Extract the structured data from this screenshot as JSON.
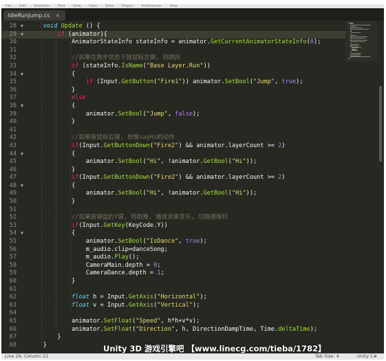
{
  "menubar": {
    "items": [
      "File",
      "Edit",
      "Selection",
      "Find",
      "View",
      "Goto",
      "Tools",
      "Project",
      "Preferences",
      "Help"
    ]
  },
  "tab": {
    "label": "IdleRunJump.cs",
    "close": "×"
  },
  "code": {
    "lines": [
      {
        "n": "28",
        "current": false,
        "fold": "▼",
        "tokens": [
          [
            "pl",
            "    "
          ],
          [
            "ty",
            "void"
          ],
          [
            "pl",
            " "
          ],
          [
            "fn",
            "Update"
          ],
          [
            "pl",
            " () {"
          ]
        ]
      },
      {
        "n": "29",
        "current": true,
        "fold": "▼",
        "tokens": [
          [
            "pl",
            "        "
          ],
          [
            "kw",
            "if"
          ],
          [
            "pl",
            " (animator){"
          ]
        ]
      },
      {
        "n": "30",
        "current": false,
        "fold": "",
        "tokens": [
          [
            "pl",
            "            AnimatorStateInfo stateInfo = animator."
          ],
          [
            "fn",
            "GetCurrentAnimatorStateInfo"
          ],
          [
            "pl",
            "("
          ],
          [
            "nu",
            "0"
          ],
          [
            "pl",
            ");"
          ]
        ]
      },
      {
        "n": "31",
        "current": false,
        "fold": "",
        "tokens": []
      },
      {
        "n": "32",
        "current": false,
        "fold": "",
        "tokens": [
          [
            "pl",
            "            "
          ],
          [
            "cm",
            "//如果在跑步状态下按鼠标左键, 则跳跃"
          ]
        ]
      },
      {
        "n": "33",
        "current": false,
        "fold": "",
        "tokens": [
          [
            "pl",
            "            "
          ],
          [
            "kw",
            "if"
          ],
          [
            "pl",
            " (stateInfo."
          ],
          [
            "fn",
            "IsName"
          ],
          [
            "pl",
            "("
          ],
          [
            "st",
            "\"Base Layer.Run\""
          ],
          [
            "pl",
            "))"
          ]
        ]
      },
      {
        "n": "34",
        "current": false,
        "fold": "▼",
        "tokens": [
          [
            "pl",
            "            {"
          ]
        ]
      },
      {
        "n": "35",
        "current": false,
        "fold": "",
        "tokens": [
          [
            "pl",
            "                "
          ],
          [
            "kw",
            "if"
          ],
          [
            "pl",
            " (Input."
          ],
          [
            "fn",
            "GetButton"
          ],
          [
            "pl",
            "("
          ],
          [
            "st",
            "\"Fire1\""
          ],
          [
            "pl",
            ")) animator."
          ],
          [
            "fn",
            "SetBool"
          ],
          [
            "pl",
            "("
          ],
          [
            "st",
            "\"Jump\""
          ],
          [
            "pl",
            ", "
          ],
          [
            "nu",
            "true"
          ],
          [
            "pl",
            ");"
          ]
        ]
      },
      {
        "n": "36",
        "current": false,
        "fold": "",
        "tokens": [
          [
            "pl",
            "            }"
          ]
        ]
      },
      {
        "n": "37",
        "current": false,
        "fold": "",
        "tokens": [
          [
            "pl",
            "            "
          ],
          [
            "kw",
            "else"
          ]
        ]
      },
      {
        "n": "38",
        "current": false,
        "fold": "▼",
        "tokens": [
          [
            "pl",
            "            {"
          ]
        ]
      },
      {
        "n": "39",
        "current": false,
        "fold": "",
        "tokens": [
          [
            "pl",
            "                animator."
          ],
          [
            "fn",
            "SetBool"
          ],
          [
            "pl",
            "("
          ],
          [
            "st",
            "\"Jump\""
          ],
          [
            "pl",
            ", "
          ],
          [
            "nu",
            "false"
          ],
          [
            "pl",
            ");"
          ]
        ]
      },
      {
        "n": "40",
        "current": false,
        "fold": "",
        "tokens": [
          [
            "pl",
            "            }"
          ]
        ]
      },
      {
        "n": "41",
        "current": false,
        "fold": "",
        "tokens": []
      },
      {
        "n": "42",
        "current": false,
        "fold": "",
        "tokens": [
          [
            "pl",
            "            "
          ],
          [
            "cm",
            "//如果按鼠标右键, 就做sayHi的动作"
          ]
        ]
      },
      {
        "n": "43",
        "current": false,
        "fold": "",
        "tokens": [
          [
            "pl",
            "            "
          ],
          [
            "kw",
            "if"
          ],
          [
            "pl",
            "(Input."
          ],
          [
            "fn",
            "GetButtonDown"
          ],
          [
            "pl",
            "("
          ],
          [
            "st",
            "\"Fire2\""
          ],
          [
            "pl",
            ") && animator.layerCount >= "
          ],
          [
            "nu",
            "2"
          ],
          [
            "pl",
            ")"
          ]
        ]
      },
      {
        "n": "44",
        "current": false,
        "fold": "▼",
        "tokens": [
          [
            "pl",
            "            {"
          ]
        ]
      },
      {
        "n": "45",
        "current": false,
        "fold": "",
        "tokens": [
          [
            "pl",
            "                animator."
          ],
          [
            "fn",
            "SetBool"
          ],
          [
            "pl",
            "("
          ],
          [
            "st",
            "\"Hi\""
          ],
          [
            "pl",
            ", !animator."
          ],
          [
            "fn",
            "GetBool"
          ],
          [
            "pl",
            "("
          ],
          [
            "st",
            "\"Hi\""
          ],
          [
            "pl",
            "));"
          ]
        ]
      },
      {
        "n": "46",
        "current": false,
        "fold": "",
        "tokens": [
          [
            "pl",
            "            }"
          ]
        ]
      },
      {
        "n": "47",
        "current": false,
        "fold": "",
        "tokens": [
          [
            "pl",
            "            "
          ],
          [
            "kw",
            "if"
          ],
          [
            "pl",
            "(Input."
          ],
          [
            "fn",
            "GetButtonDown"
          ],
          [
            "pl",
            "("
          ],
          [
            "st",
            "\"Fire2\""
          ],
          [
            "pl",
            ") && animator.layerCount >= "
          ],
          [
            "nu",
            "2"
          ],
          [
            "pl",
            ")"
          ]
        ]
      },
      {
        "n": "48",
        "current": false,
        "fold": "▼",
        "tokens": [
          [
            "pl",
            "            {"
          ]
        ]
      },
      {
        "n": "49",
        "current": false,
        "fold": "",
        "tokens": [
          [
            "pl",
            "                animator."
          ],
          [
            "fn",
            "SetBool"
          ],
          [
            "pl",
            "("
          ],
          [
            "st",
            "\"Hi\""
          ],
          [
            "pl",
            ", !animator."
          ],
          [
            "fn",
            "GetBool"
          ],
          [
            "pl",
            "("
          ],
          [
            "st",
            "\"Hi\""
          ],
          [
            "pl",
            "));"
          ]
        ]
      },
      {
        "n": "50",
        "current": false,
        "fold": "",
        "tokens": [
          [
            "pl",
            "            }"
          ]
        ]
      },
      {
        "n": "51",
        "current": false,
        "fold": "",
        "tokens": []
      },
      {
        "n": "52",
        "current": false,
        "fold": "",
        "tokens": [
          [
            "pl",
            "            "
          ],
          [
            "cm",
            "//如果按键盘的Y键, 则跳舞, 播放背景音乐, 切换摄像机"
          ]
        ]
      },
      {
        "n": "53",
        "current": false,
        "fold": "",
        "tokens": [
          [
            "pl",
            "            "
          ],
          [
            "kw",
            "if"
          ],
          [
            "pl",
            "(Input."
          ],
          [
            "fn",
            "GetKey"
          ],
          [
            "pl",
            "(KeyCode.Y))"
          ]
        ]
      },
      {
        "n": "54",
        "current": false,
        "fold": "▼",
        "tokens": [
          [
            "pl",
            "            {"
          ]
        ]
      },
      {
        "n": "55",
        "current": false,
        "fold": "",
        "tokens": [
          [
            "pl",
            "                animator."
          ],
          [
            "fn",
            "SetBool"
          ],
          [
            "pl",
            "("
          ],
          [
            "st",
            "\"IsDance\""
          ],
          [
            "pl",
            ", "
          ],
          [
            "nu",
            "true"
          ],
          [
            "pl",
            ");"
          ]
        ]
      },
      {
        "n": "56",
        "current": false,
        "fold": "",
        "tokens": [
          [
            "pl",
            "                m_audio.clip=danceSong;"
          ]
        ]
      },
      {
        "n": "57",
        "current": false,
        "fold": "",
        "tokens": [
          [
            "pl",
            "                m_audio."
          ],
          [
            "fn",
            "Play"
          ],
          [
            "pl",
            "();"
          ]
        ]
      },
      {
        "n": "58",
        "current": false,
        "fold": "",
        "tokens": [
          [
            "pl",
            "                CameraMain.depth = "
          ],
          [
            "nu",
            "0"
          ],
          [
            "pl",
            ";"
          ]
        ]
      },
      {
        "n": "59",
        "current": false,
        "fold": "",
        "tokens": [
          [
            "pl",
            "                CameraDance.depth = "
          ],
          [
            "nu",
            "1"
          ],
          [
            "pl",
            ";"
          ]
        ]
      },
      {
        "n": "60",
        "current": false,
        "fold": "",
        "tokens": [
          [
            "pl",
            "            }"
          ]
        ]
      },
      {
        "n": "61",
        "current": false,
        "fold": "",
        "tokens": []
      },
      {
        "n": "62",
        "current": false,
        "fold": "",
        "tokens": [
          [
            "pl",
            "            "
          ],
          [
            "ty",
            "float"
          ],
          [
            "pl",
            " h = Input."
          ],
          [
            "fn",
            "GetAxis"
          ],
          [
            "pl",
            "("
          ],
          [
            "st",
            "\"Horizontal\""
          ],
          [
            "pl",
            ");"
          ]
        ]
      },
      {
        "n": "63",
        "current": false,
        "fold": "",
        "tokens": [
          [
            "pl",
            "            "
          ],
          [
            "ty",
            "float"
          ],
          [
            "pl",
            " v = Input."
          ],
          [
            "fn",
            "GetAxis"
          ],
          [
            "pl",
            "("
          ],
          [
            "st",
            "\"Vertical\""
          ],
          [
            "pl",
            ");"
          ]
        ]
      },
      {
        "n": "64",
        "current": false,
        "fold": "",
        "tokens": []
      },
      {
        "n": "65",
        "current": false,
        "fold": "",
        "tokens": [
          [
            "pl",
            "            animator."
          ],
          [
            "fn",
            "SetFloat"
          ],
          [
            "pl",
            "("
          ],
          [
            "st",
            "\"Speed\""
          ],
          [
            "pl",
            ", h*h+v*v);"
          ]
        ]
      },
      {
        "n": "66",
        "current": false,
        "fold": "",
        "tokens": [
          [
            "pl",
            "            animator."
          ],
          [
            "fn",
            "SetFloat"
          ],
          [
            "pl",
            "("
          ],
          [
            "st",
            "\"Direction\""
          ],
          [
            "pl",
            ", h, DirectionDampTime, Time."
          ],
          [
            "fn",
            "deltaTime"
          ],
          [
            "pl",
            ");"
          ]
        ]
      },
      {
        "n": "67",
        "current": false,
        "fold": "",
        "tokens": [
          [
            "pl",
            "        }"
          ]
        ]
      },
      {
        "n": "68",
        "current": false,
        "fold": "",
        "tokens": [
          [
            "pl",
            "    }"
          ]
        ]
      }
    ]
  },
  "status": {
    "position": "Line 29, Column 22",
    "tab_size": "Tab Size: 4",
    "syntax": "Unity C#"
  },
  "watermark": "Unity 3D 游戏引擎吧 【www.linecg.com/tieba/1782】",
  "colors": {
    "background": "#272822",
    "keyword": "#f92672",
    "type": "#66d9ef",
    "function": "#a6e22e",
    "string": "#e6db74",
    "number": "#ae81ff",
    "comment": "#75715e"
  }
}
